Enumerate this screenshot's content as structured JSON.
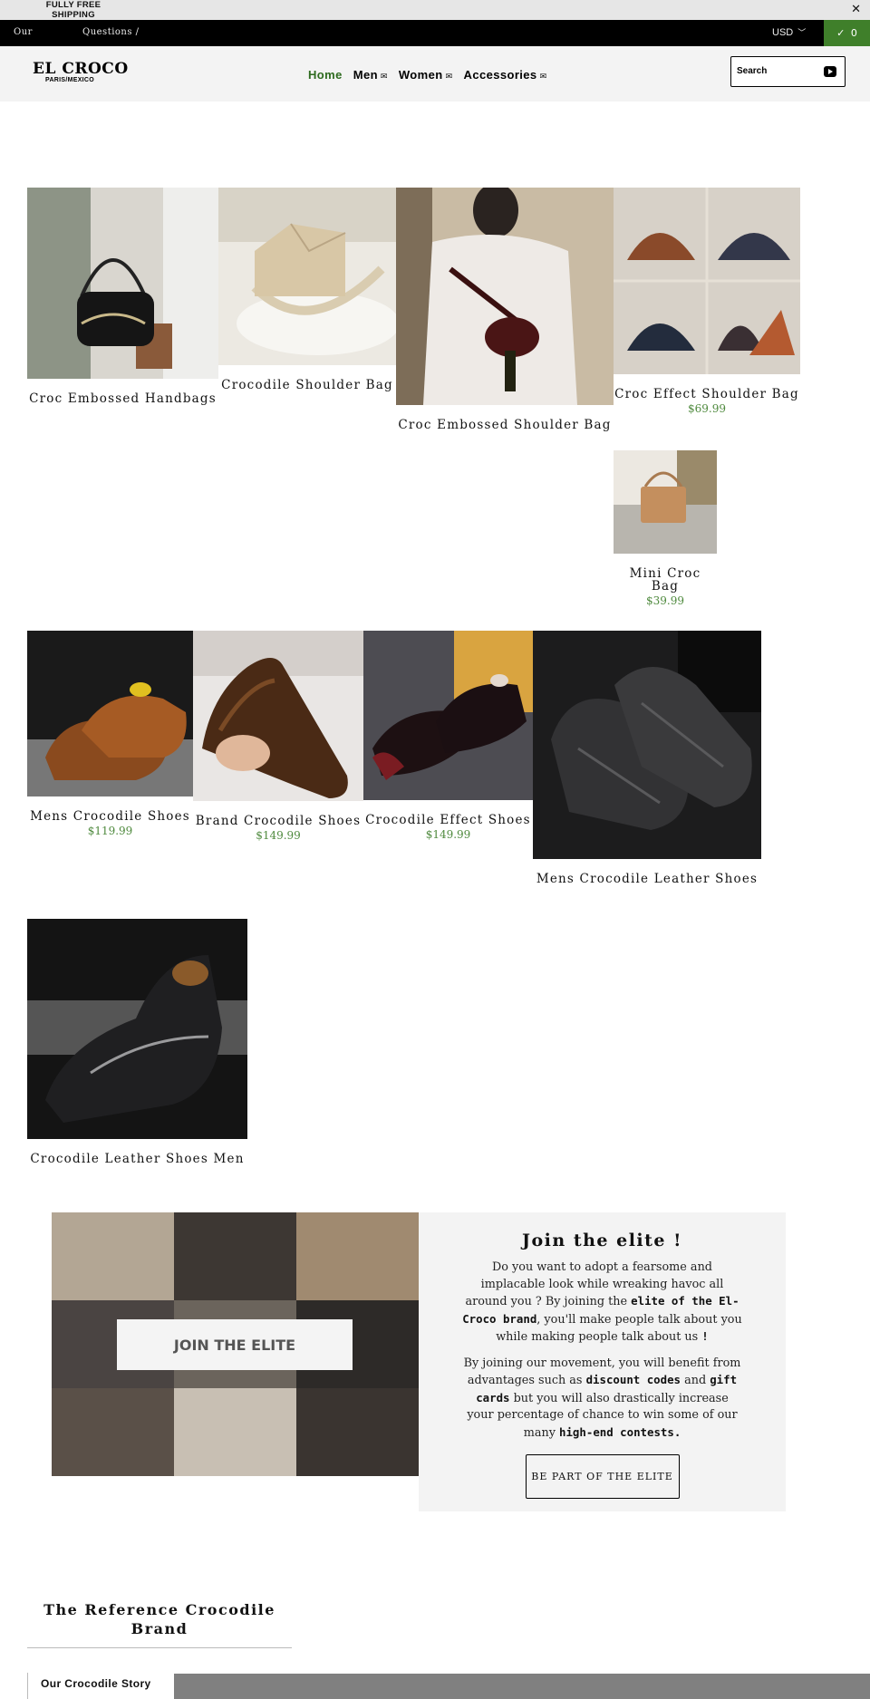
{
  "promo": {
    "text": "FULLY FREE SHIPPING",
    "close_icon": "close-icon"
  },
  "topbar": {
    "link_our": "Our",
    "link_questions": "Questions /",
    "currency": "USD",
    "cart_count": "0",
    "cart_icon": "check-icon"
  },
  "header": {
    "logo": "EL CROCO",
    "logo_sub": "PARIS/MEXICO",
    "nav": [
      {
        "label": "Home",
        "active": true
      },
      {
        "label": "Men",
        "caret_icon": "envelope-caret-icon"
      },
      {
        "label": "Women",
        "caret_icon": "envelope-caret-icon"
      },
      {
        "label": "Accessories",
        "caret_icon": "envelope-caret-icon"
      }
    ],
    "search": {
      "placeholder": "Search",
      "button_icon": "play-icon"
    }
  },
  "products": [
    {
      "title": "Croc Embossed Handbags",
      "price": ""
    },
    {
      "title": "Crocodile Shoulder Bag",
      "price": ""
    },
    {
      "title": "Croc Embossed Shoulder Bag",
      "price": ""
    },
    {
      "title": "Croc Effect Shoulder Bag",
      "price": "$69.99"
    },
    {
      "title": "Mini Croc Bag",
      "price": "$39.99"
    },
    {
      "title": "Mens Crocodile Shoes",
      "price": "$119.99"
    },
    {
      "title": "Brand Crocodile Shoes",
      "price": "$149.99"
    },
    {
      "title": "Crocodile Effect Shoes",
      "price": "$149.99"
    },
    {
      "title": "Mens Crocodile Leather Shoes",
      "price": ""
    },
    {
      "title": "Crocodile Leather Shoes Men",
      "price": ""
    }
  ],
  "join": {
    "title": "Join the elite !",
    "p1_a": "Do you want to adopt a fearsome and implacable look while wreaking havoc all around you ? By joining the ",
    "p1_b": "elite of the El-Croco brand",
    "p1_c": ", you'll make people talk about you while making people talk about us ",
    "p1_d": "!",
    "p2_a": "By joining our movement, you will benefit from advantages such as ",
    "p2_b": "discount codes",
    "p2_c": " and ",
    "p2_d": "gift cards",
    "p2_e": " but you will also drastically increase your percentage of chance to win some of our many ",
    "p2_f": "high-end contests.",
    "button": "BE PART OF THE ELITE",
    "image_caption": "JOIN THE ELITE"
  },
  "footer": {
    "title": "The Reference Crocodile Brand",
    "story": "Our Crocodile Story"
  }
}
